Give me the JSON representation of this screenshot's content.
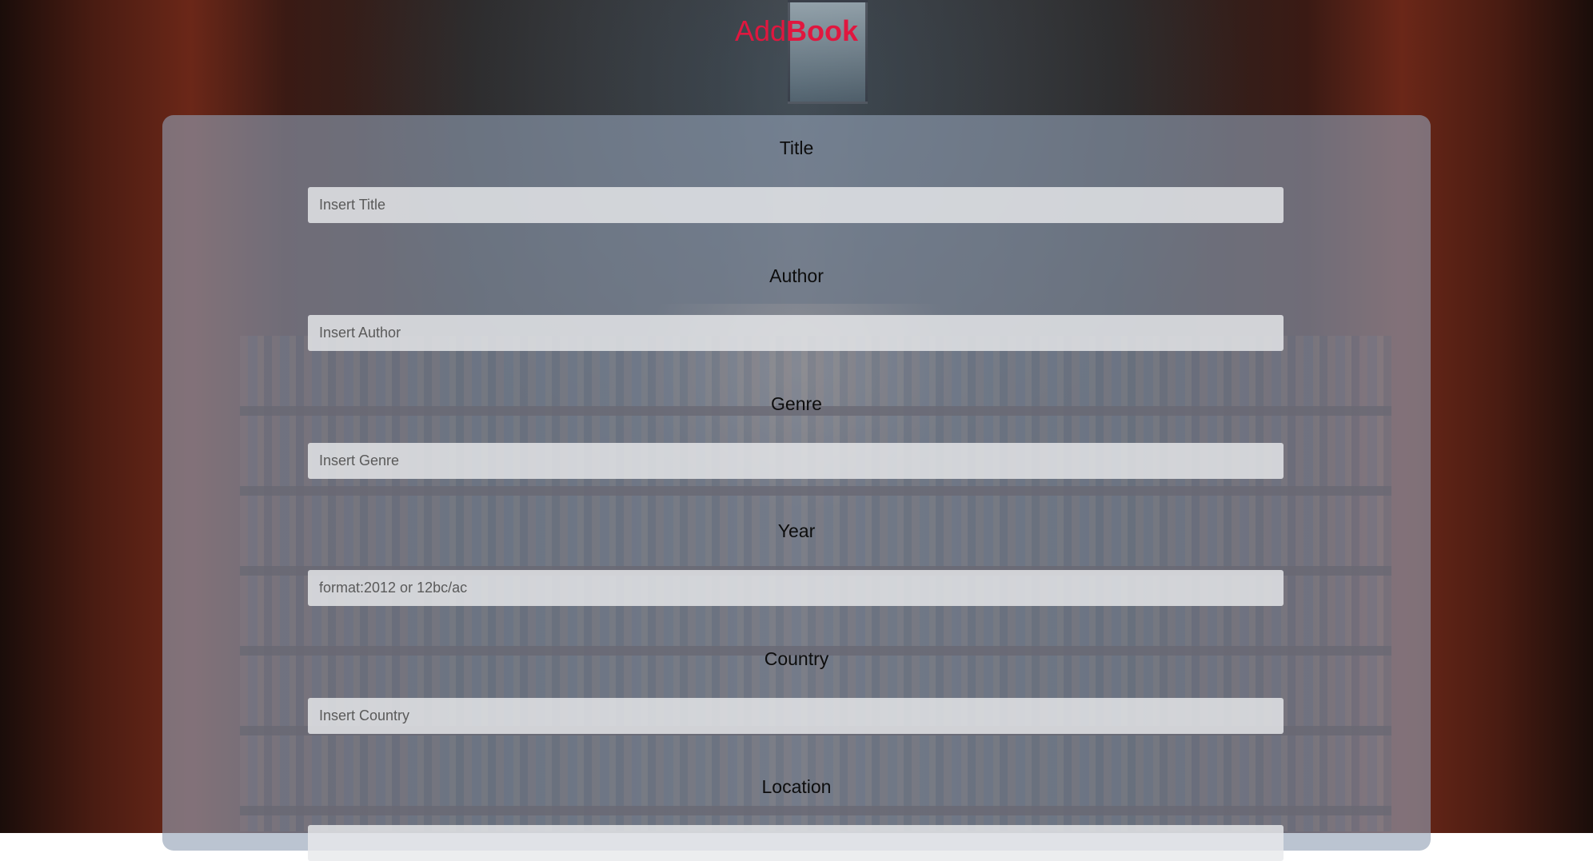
{
  "header": {
    "title_part1": "Add",
    "title_part2": "Book",
    "accent_color": "#e0173f"
  },
  "form": {
    "fields": [
      {
        "label": "Title",
        "placeholder": "Insert Title"
      },
      {
        "label": "Author",
        "placeholder": "Insert Author"
      },
      {
        "label": "Genre",
        "placeholder": "Insert Genre"
      },
      {
        "label": "Year",
        "placeholder": "format:2012 or 12bc/ac"
      },
      {
        "label": "Country",
        "placeholder": "Insert Country"
      },
      {
        "label": "Location",
        "placeholder": ""
      }
    ]
  }
}
